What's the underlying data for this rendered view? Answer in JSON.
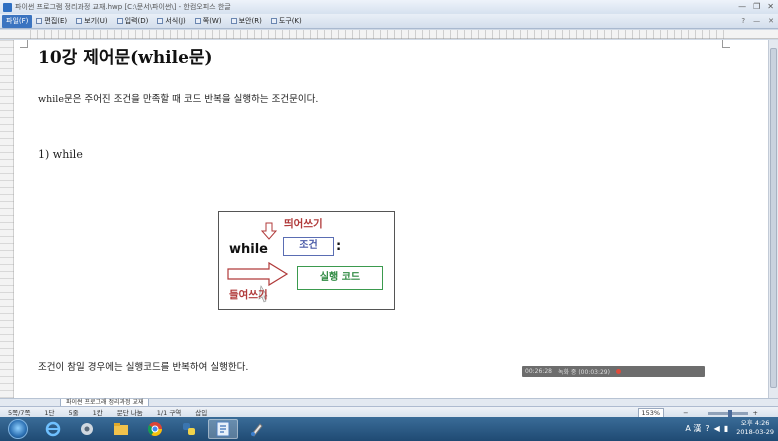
{
  "titlebar": {
    "title": "파이썬 프로그램 정리과정 교재.hwp [C:\\문서\\파이썬\\] - 한컴오피스 한글",
    "controls": [
      "—",
      "❐",
      "✕"
    ]
  },
  "menubar": {
    "file": "파일(F)",
    "items": [
      "편집(E)",
      "보기(U)",
      "입력(D)",
      "서식(J)",
      "쪽(W)",
      "보안(R)",
      "도구(K)"
    ],
    "right": [
      "?",
      "—",
      "✕"
    ]
  },
  "document": {
    "heading": "10강 제어문(while문)",
    "para1": "while문은 주어진 조건을 만족할 때 코드 반복을 실행하는 조건문이다.",
    "sub_heading": "1)  while",
    "diagram": {
      "while_keyword": "while",
      "indent_top": "띄어쓰기",
      "condition": "조건",
      "colon": ":",
      "code": "실행 코드",
      "indent_bottom": "들여쓰기",
      "colors": {
        "red": "#b03a3a",
        "blue": "#4a5ba8",
        "green": "#2f8a42"
      }
    },
    "para2": "조건이 참일 경우에는 실행코드를 반복하여 실행한다."
  },
  "floatbar": {
    "left": "00:26:28",
    "right": "녹화 중 (00:03:29)"
  },
  "tabstrip": {
    "doc_tab": "파이썬 프로그래 정리과정 교재"
  },
  "statusbar": {
    "items": [
      "5쪽/7쪽",
      "1단",
      "5줄",
      "1칸",
      "문단 나눔",
      "1/1 구역",
      "삽입"
    ],
    "zoom": "153%"
  },
  "taskbar": {
    "apps": [
      "ie-icon",
      "media-icon",
      "folder-icon",
      "chrome-icon",
      "python-icon",
      "hwp-icon",
      "paint-icon"
    ],
    "tray_lang": "A 漢",
    "clock_time": "오후 4:26",
    "clock_date": "2018-03-29"
  }
}
